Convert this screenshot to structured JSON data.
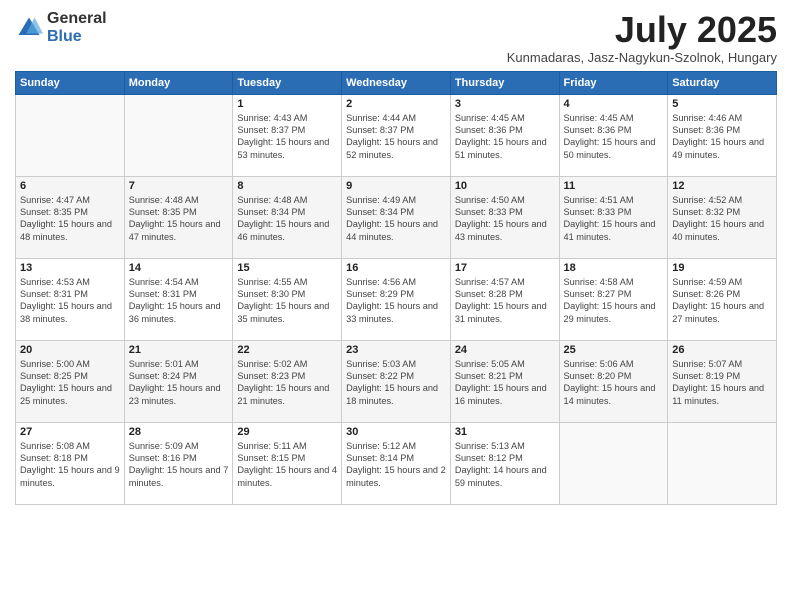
{
  "logo": {
    "general": "General",
    "blue": "Blue"
  },
  "header": {
    "month": "July 2025",
    "location": "Kunmadaras, Jasz-Nagykun-Szolnok, Hungary"
  },
  "weekdays": [
    "Sunday",
    "Monday",
    "Tuesday",
    "Wednesday",
    "Thursday",
    "Friday",
    "Saturday"
  ],
  "weeks": [
    [
      {
        "day": "",
        "info": ""
      },
      {
        "day": "",
        "info": ""
      },
      {
        "day": "1",
        "info": "Sunrise: 4:43 AM\nSunset: 8:37 PM\nDaylight: 15 hours and 53 minutes."
      },
      {
        "day": "2",
        "info": "Sunrise: 4:44 AM\nSunset: 8:37 PM\nDaylight: 15 hours and 52 minutes."
      },
      {
        "day": "3",
        "info": "Sunrise: 4:45 AM\nSunset: 8:36 PM\nDaylight: 15 hours and 51 minutes."
      },
      {
        "day": "4",
        "info": "Sunrise: 4:45 AM\nSunset: 8:36 PM\nDaylight: 15 hours and 50 minutes."
      },
      {
        "day": "5",
        "info": "Sunrise: 4:46 AM\nSunset: 8:36 PM\nDaylight: 15 hours and 49 minutes."
      }
    ],
    [
      {
        "day": "6",
        "info": "Sunrise: 4:47 AM\nSunset: 8:35 PM\nDaylight: 15 hours and 48 minutes."
      },
      {
        "day": "7",
        "info": "Sunrise: 4:48 AM\nSunset: 8:35 PM\nDaylight: 15 hours and 47 minutes."
      },
      {
        "day": "8",
        "info": "Sunrise: 4:48 AM\nSunset: 8:34 PM\nDaylight: 15 hours and 46 minutes."
      },
      {
        "day": "9",
        "info": "Sunrise: 4:49 AM\nSunset: 8:34 PM\nDaylight: 15 hours and 44 minutes."
      },
      {
        "day": "10",
        "info": "Sunrise: 4:50 AM\nSunset: 8:33 PM\nDaylight: 15 hours and 43 minutes."
      },
      {
        "day": "11",
        "info": "Sunrise: 4:51 AM\nSunset: 8:33 PM\nDaylight: 15 hours and 41 minutes."
      },
      {
        "day": "12",
        "info": "Sunrise: 4:52 AM\nSunset: 8:32 PM\nDaylight: 15 hours and 40 minutes."
      }
    ],
    [
      {
        "day": "13",
        "info": "Sunrise: 4:53 AM\nSunset: 8:31 PM\nDaylight: 15 hours and 38 minutes."
      },
      {
        "day": "14",
        "info": "Sunrise: 4:54 AM\nSunset: 8:31 PM\nDaylight: 15 hours and 36 minutes."
      },
      {
        "day": "15",
        "info": "Sunrise: 4:55 AM\nSunset: 8:30 PM\nDaylight: 15 hours and 35 minutes."
      },
      {
        "day": "16",
        "info": "Sunrise: 4:56 AM\nSunset: 8:29 PM\nDaylight: 15 hours and 33 minutes."
      },
      {
        "day": "17",
        "info": "Sunrise: 4:57 AM\nSunset: 8:28 PM\nDaylight: 15 hours and 31 minutes."
      },
      {
        "day": "18",
        "info": "Sunrise: 4:58 AM\nSunset: 8:27 PM\nDaylight: 15 hours and 29 minutes."
      },
      {
        "day": "19",
        "info": "Sunrise: 4:59 AM\nSunset: 8:26 PM\nDaylight: 15 hours and 27 minutes."
      }
    ],
    [
      {
        "day": "20",
        "info": "Sunrise: 5:00 AM\nSunset: 8:25 PM\nDaylight: 15 hours and 25 minutes."
      },
      {
        "day": "21",
        "info": "Sunrise: 5:01 AM\nSunset: 8:24 PM\nDaylight: 15 hours and 23 minutes."
      },
      {
        "day": "22",
        "info": "Sunrise: 5:02 AM\nSunset: 8:23 PM\nDaylight: 15 hours and 21 minutes."
      },
      {
        "day": "23",
        "info": "Sunrise: 5:03 AM\nSunset: 8:22 PM\nDaylight: 15 hours and 18 minutes."
      },
      {
        "day": "24",
        "info": "Sunrise: 5:05 AM\nSunset: 8:21 PM\nDaylight: 15 hours and 16 minutes."
      },
      {
        "day": "25",
        "info": "Sunrise: 5:06 AM\nSunset: 8:20 PM\nDaylight: 15 hours and 14 minutes."
      },
      {
        "day": "26",
        "info": "Sunrise: 5:07 AM\nSunset: 8:19 PM\nDaylight: 15 hours and 11 minutes."
      }
    ],
    [
      {
        "day": "27",
        "info": "Sunrise: 5:08 AM\nSunset: 8:18 PM\nDaylight: 15 hours and 9 minutes."
      },
      {
        "day": "28",
        "info": "Sunrise: 5:09 AM\nSunset: 8:16 PM\nDaylight: 15 hours and 7 minutes."
      },
      {
        "day": "29",
        "info": "Sunrise: 5:11 AM\nSunset: 8:15 PM\nDaylight: 15 hours and 4 minutes."
      },
      {
        "day": "30",
        "info": "Sunrise: 5:12 AM\nSunset: 8:14 PM\nDaylight: 15 hours and 2 minutes."
      },
      {
        "day": "31",
        "info": "Sunrise: 5:13 AM\nSunset: 8:12 PM\nDaylight: 14 hours and 59 minutes."
      },
      {
        "day": "",
        "info": ""
      },
      {
        "day": "",
        "info": ""
      }
    ]
  ]
}
